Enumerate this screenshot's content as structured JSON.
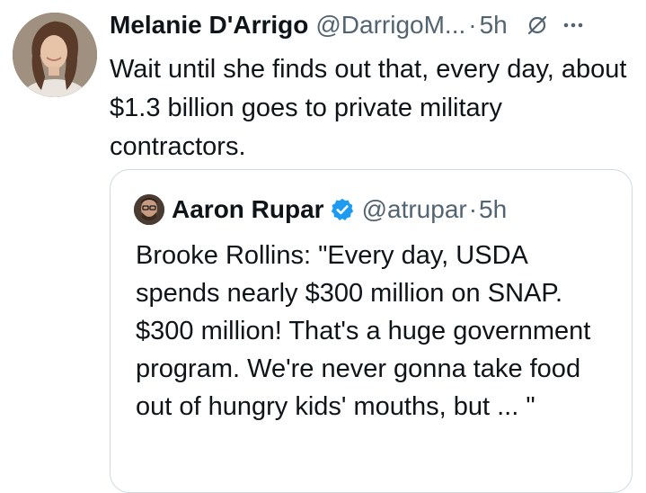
{
  "tweet": {
    "display_name": "Melanie D'Arrigo",
    "handle": "@DarrigoM...",
    "separator": "·",
    "time": "5h",
    "text": "Wait until she finds out that, every day, about $1.3 billion goes to private military contractors.",
    "icons": {
      "avatar": "avatar-photo",
      "grok": "slashed-circle-icon",
      "more": "more-icon"
    }
  },
  "quote": {
    "display_name": "Aaron Rupar",
    "handle": "@atrupar",
    "separator": "·",
    "time": "5h",
    "text": "Brooke Rollins: \"Every day, USDA spends nearly $300 million on SNAP. $300 million! That's a huge government program. We're never gonna take food out of hungry kids' mouths, but ... \"",
    "icons": {
      "avatar": "avatar-photo",
      "verified": "verified-badge-icon"
    }
  },
  "colors": {
    "text_primary": "#0f1419",
    "text_secondary": "#536471",
    "verified_blue": "#1d9bf0",
    "border": "#cfd9de"
  }
}
